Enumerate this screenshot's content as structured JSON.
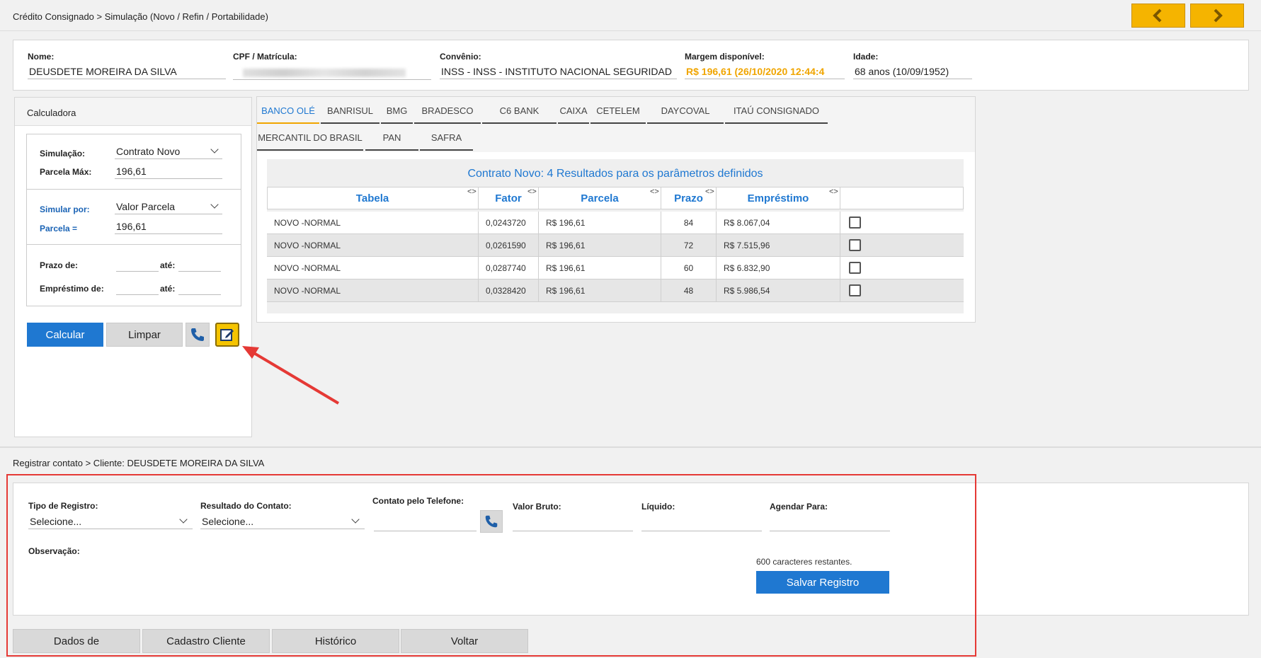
{
  "breadcrumb_top": "Crédito Consignado > Simulação (Novo / Refin / Portabilidade)",
  "client": {
    "nome_label": "Nome:",
    "nome_value": "DEUSDETE MOREIRA DA SILVA",
    "cpf_label": "CPF / Matrícula:",
    "convenio_label": "Convênio:",
    "convenio_value": "INSS - INSS - INSTITUTO NACIONAL SEGURIDAD",
    "margem_label": "Margem disponível:",
    "margem_value": "R$ 196,61 (26/10/2020 12:44:4",
    "idade_label": "Idade:",
    "idade_value": "68 anos (10/09/1952)"
  },
  "calc": {
    "title": "Calculadora",
    "simulacao_label": "Simulação:",
    "simulacao_value": "Contrato Novo",
    "parcela_max_label": "Parcela Máx:",
    "parcela_max_value": "196,61",
    "simular_por_label": "Simular por:",
    "simular_por_value": "Valor Parcela",
    "parcela_eq_label": "Parcela =",
    "parcela_eq_value": "196,61",
    "prazo_label": "Prazo de:",
    "ate_label": "até:",
    "emprestimo_label": "Empréstimo de:",
    "ate2_label": "até:",
    "calcular_label": "Calcular",
    "limpar_label": "Limpar"
  },
  "tabs_row1": [
    "BANCO OLÉ",
    "BANRISUL",
    "BMG",
    "BRADESCO",
    "C6 BANK",
    "CAIXA",
    "CETELEM",
    "DAYCOVAL",
    "ITAÚ CONSIGNADO"
  ],
  "tabs_row2": [
    "MERCANTIL DO BRASIL",
    "PAN",
    "SAFRA"
  ],
  "results": {
    "title": "Contrato Novo: 4 Resultados para os parâmetros definidos",
    "headers": [
      "Tabela",
      "Fator",
      "Parcela",
      "Prazo",
      "Empréstimo"
    ],
    "rows": [
      {
        "tabela": "NOVO -NORMAL",
        "fator": "0,0243720",
        "parcela": "R$ 196,61",
        "prazo": "84",
        "emprestimo": "R$ 8.067,04"
      },
      {
        "tabela": "NOVO -NORMAL",
        "fator": "0,0261590",
        "parcela": "R$ 196,61",
        "prazo": "72",
        "emprestimo": "R$ 7.515,96"
      },
      {
        "tabela": "NOVO -NORMAL",
        "fator": "0,0287740",
        "parcela": "R$ 196,61",
        "prazo": "60",
        "emprestimo": "R$ 6.832,90"
      },
      {
        "tabela": "NOVO -NORMAL",
        "fator": "0,0328420",
        "parcela": "R$ 196,61",
        "prazo": "48",
        "emprestimo": "R$ 5.986,54"
      }
    ]
  },
  "contact": {
    "breadcrumb": "Registrar contato > Cliente: DEUSDETE MOREIRA DA SILVA",
    "tipo_label": "Tipo de Registro:",
    "tipo_value": "Selecione...",
    "resultado_label": "Resultado do Contato:",
    "resultado_value": "Selecione...",
    "telefone_label": "Contato pelo Telefone:",
    "valor_bruto_label": "Valor Bruto:",
    "liquido_label": "Líquido:",
    "agendar_label": "Agendar Para:",
    "observacao_label": "Observação:",
    "chars_remaining": "600 caracteres restantes.",
    "salvar_label": "Salvar Registro"
  },
  "bottom_buttons": [
    "Dados de",
    "Cadastro Cliente",
    "Histórico",
    "Voltar"
  ],
  "colors": {
    "accent_blue": "#1f78d1",
    "accent_orange": "#f0a500",
    "highlight_red": "#e53935"
  }
}
